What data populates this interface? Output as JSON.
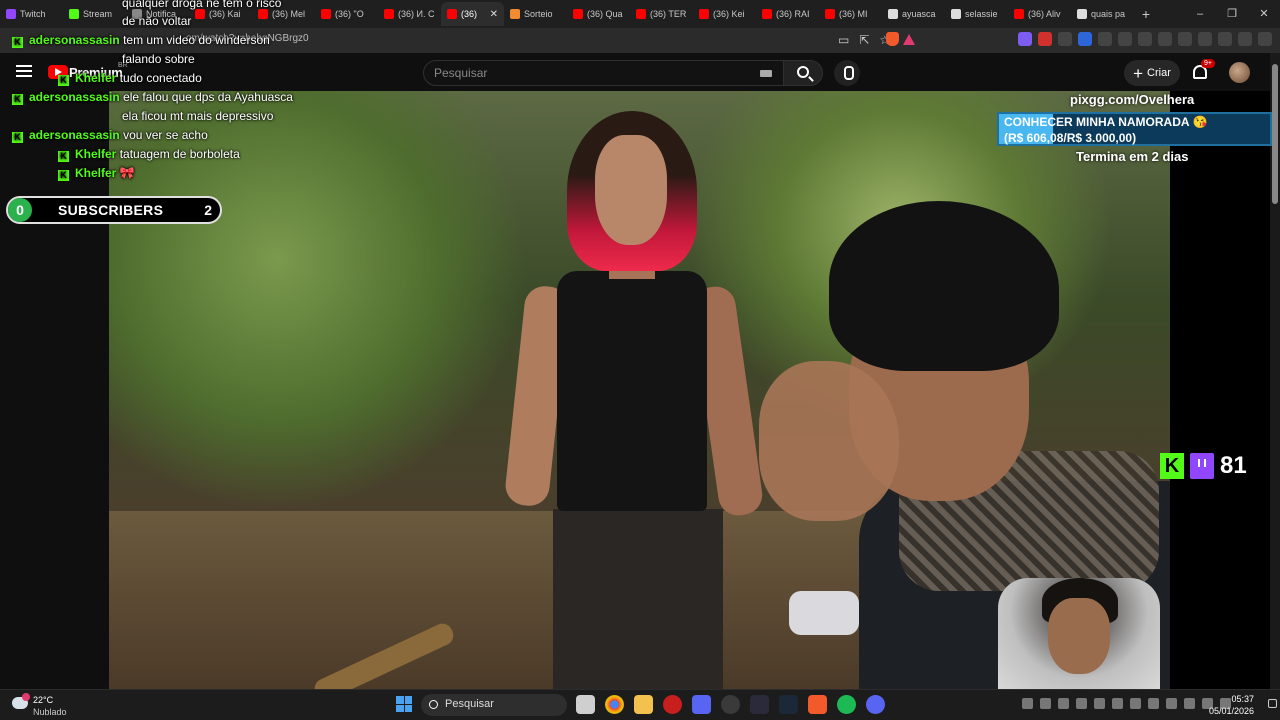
{
  "browser": {
    "tabs": [
      {
        "label": "Twitch",
        "color": "#9146ff"
      },
      {
        "label": "Stream",
        "color": "#53fc18"
      },
      {
        "label": "Notifica",
        "color": "#888888"
      },
      {
        "label": "(36) Kai",
        "color": "#ff0000"
      },
      {
        "label": "(36) Mel",
        "color": "#ff0000"
      },
      {
        "label": "(36) \"O",
        "color": "#ff0000"
      },
      {
        "label": "(36) И. С",
        "color": "#ff0000"
      },
      {
        "label": "(36) ",
        "color": "#ff0000",
        "active": true
      },
      {
        "label": "Sorteio",
        "color": "#f28b30"
      },
      {
        "label": "(36) Qua",
        "color": "#ff0000"
      },
      {
        "label": "(36) TER",
        "color": "#ff0000"
      },
      {
        "label": "(36) Kei",
        "color": "#ff0000"
      },
      {
        "label": "(36) RAI",
        "color": "#ff0000"
      },
      {
        "label": "(36) MI",
        "color": "#ff0000"
      },
      {
        "label": "ayuasca",
        "color": "#dddddd"
      },
      {
        "label": "selassie",
        "color": "#dddddd"
      },
      {
        "label": "(36) Aliv",
        "color": "#ff0000"
      },
      {
        "label": "quais pa",
        "color": "#dddddd"
      }
    ],
    "new_tab": "+",
    "url": "om/watch?v=hobqNGBrgz0",
    "window_controls": [
      "–",
      "❐",
      "✕"
    ]
  },
  "youtube": {
    "logo_text": "Premium",
    "region": "BR",
    "search_placeholder": "Pesquisar",
    "create_label": "Criar",
    "create_icon": "+",
    "notification_badge": "9+"
  },
  "chat": [
    {
      "user": "",
      "message": "qualquer droga ne tem o risco",
      "kick": false
    },
    {
      "user": "",
      "message": "de não voltar",
      "kick": false
    },
    {
      "user": "adersonassasin",
      "message": "tem um video do winderson",
      "kick": true
    },
    {
      "user": "",
      "message": "falando sobre",
      "kick": false
    },
    {
      "user": "Khelfer",
      "message": "tudo conectado",
      "kick": true
    },
    {
      "user": "adersonassasin",
      "message": "ele falou que dps da Ayahuasca",
      "kick": true
    },
    {
      "user": "",
      "message": "ela ficou mt mais depressivo",
      "kick": false
    },
    {
      "user": "adersonassasin",
      "message": "vou ver se acho",
      "kick": true
    },
    {
      "user": "Khelfer",
      "message": "tatuagem de borboleta",
      "kick": true
    },
    {
      "user": "Khelfer",
      "message": "🎀",
      "kick": true
    }
  ],
  "kick_icon": "K",
  "subscribers": {
    "left_count": "0",
    "label": "SUBSCRIBERS",
    "right_count": "2"
  },
  "pix": {
    "url": "pixgg.com/Ovelhera",
    "goal": "CONHECER MINHA NAMORADA 😘",
    "amount": "(R$ 606,08/R$ 3.000,00)",
    "progress_fraction": 0.2,
    "ends": "Termina em 2 dias"
  },
  "viewers": {
    "count": "81"
  },
  "taskbar": {
    "temperature": "22°C",
    "condition": "Nublado",
    "search_placeholder": "Pesquisar",
    "time": "05:37",
    "date": "05/01/2026"
  }
}
